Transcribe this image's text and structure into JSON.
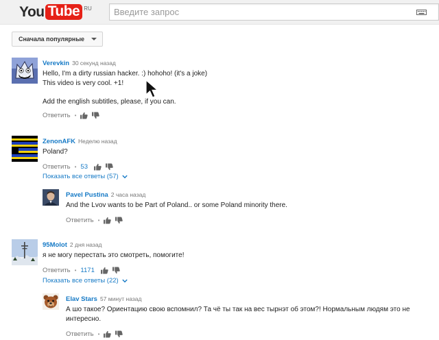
{
  "header": {
    "logo_you": "You",
    "logo_tube": "Tube",
    "logo_region": "RU",
    "search_placeholder": "Введите запрос",
    "keyboard_icon": "keyboard-icon"
  },
  "sort": {
    "label": "Сначала популярные"
  },
  "comments": [
    {
      "author": "Verevkin",
      "time": "30 секунд назад",
      "lines": [
        "Hello, I'm a dirty russian hacker. :) hohoho! (it's a joke)",
        "This video is very cool. +1!",
        "",
        "Add the english subtitles, please, if you can."
      ],
      "reply_label": "Ответить",
      "likes": ""
    },
    {
      "author": "ZenonAFK",
      "time": "Неделю назад",
      "lines": [
        "Poland?"
      ],
      "reply_label": "Ответить",
      "likes": "53",
      "show_replies": "Показать все ответы (57)",
      "reply": {
        "author": "Pavel Pustina",
        "time": "2 часа назад",
        "text": "And the Lvov wants to be Part of Poland.. or some Poland minority there.",
        "reply_label": "Ответить"
      }
    },
    {
      "author": "95Molot",
      "time": "2 дня назад",
      "lines": [
        "я не могу перестать это смотреть, помогите!"
      ],
      "reply_label": "Ответить",
      "likes": "1171",
      "show_replies": "Показать все ответы (22)",
      "reply": {
        "author": "Elav Stars",
        "time": "57 минут назад",
        "text_lines": [
          "А шо такое? Ориентацию свою вспомнил? Та чё ты так на вес тырнэт об этом?! Нормальным людям это не",
          "интересно."
        ],
        "reply_label": "Ответить"
      }
    }
  ],
  "colors": {
    "link": "#167ac6",
    "logo_red": "#e62117",
    "meta_gray": "#767676"
  }
}
